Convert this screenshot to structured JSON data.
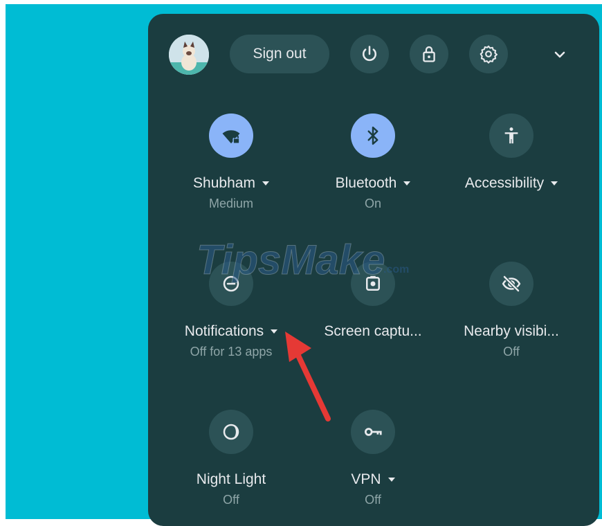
{
  "header": {
    "sign_out_label": "Sign out",
    "icons": [
      "avatar",
      "power-icon",
      "lock-icon",
      "gear-icon",
      "chevron-down-icon"
    ]
  },
  "tiles": [
    {
      "label": "Shubham",
      "sublabel": "Medium",
      "icon": "wifi-lock-icon",
      "active": true,
      "has_menu": true
    },
    {
      "label": "Bluetooth",
      "sublabel": "On",
      "icon": "bluetooth-icon",
      "active": true,
      "has_menu": true
    },
    {
      "label": "Accessibility",
      "sublabel": "",
      "icon": "accessibility-icon",
      "active": false,
      "has_menu": true
    },
    {
      "label": "Notifications",
      "sublabel": "Off for 13 apps",
      "icon": "do-not-disturb-icon",
      "active": false,
      "has_menu": true
    },
    {
      "label": "Screen captu...",
      "sublabel": "",
      "icon": "screen-capture-icon",
      "active": false,
      "has_menu": false
    },
    {
      "label": "Nearby visibi...",
      "sublabel": "Off",
      "icon": "eye-off-icon",
      "active": false,
      "has_menu": false
    },
    {
      "label": "Night Light",
      "sublabel": "Off",
      "icon": "night-light-icon",
      "active": false,
      "has_menu": false
    },
    {
      "label": "VPN",
      "sublabel": "Off",
      "icon": "vpn-key-icon",
      "active": false,
      "has_menu": true
    }
  ],
  "watermark": {
    "text": "TipsMake",
    "suffix": ".com"
  },
  "colors": {
    "desktop": "#00bcd4",
    "panel": "#1b3d40",
    "button": "#2c5256",
    "active": "#8ab4f8",
    "annotation_arrow": "#e53935"
  }
}
